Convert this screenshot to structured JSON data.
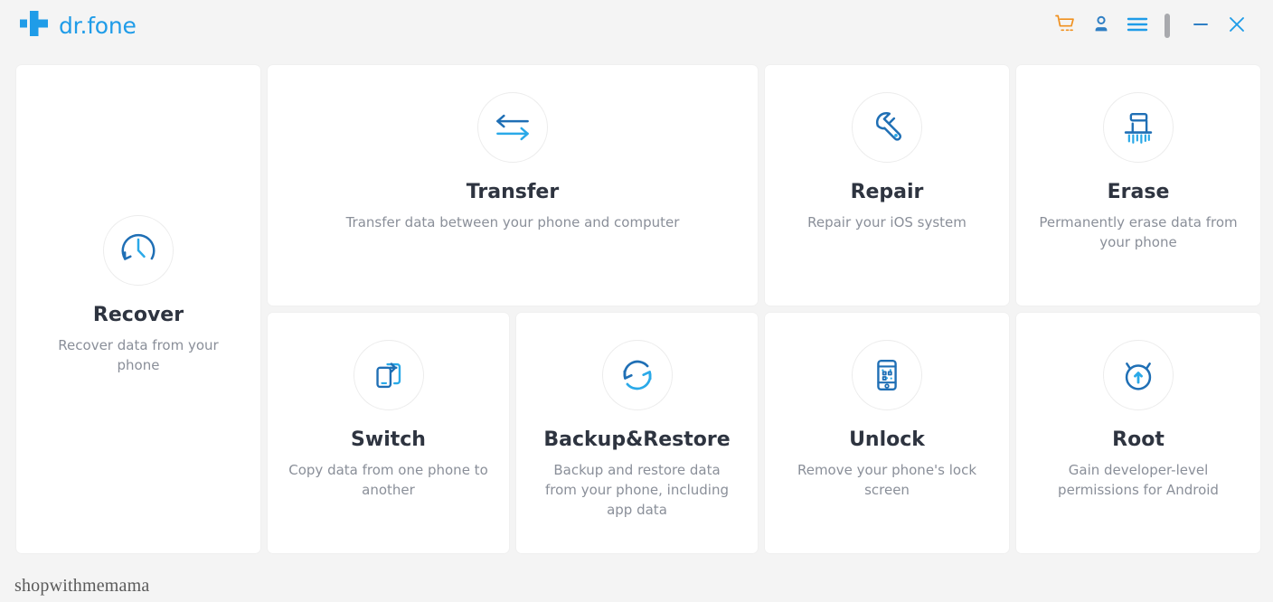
{
  "window": {
    "app_name": "dr.fone",
    "background_color": "#f4f4f4",
    "accent_color": "#1f9ce8",
    "cart_color": "#f0901e"
  },
  "titlebar": {
    "logo_icon": "plus-cross-icon",
    "actions": [
      {
        "name": "cart-icon",
        "label": "Store",
        "color": "#f0901e"
      },
      {
        "name": "account-icon",
        "label": "Account",
        "color": "#2f7fc4"
      },
      {
        "name": "menu-icon",
        "label": "Menu",
        "color": "#1f9ce8"
      },
      {
        "name": "divider",
        "label": "",
        "color": "#a8a9ad"
      },
      {
        "name": "minimize-icon",
        "label": "Minimize",
        "color": "#2f7fc4"
      },
      {
        "name": "close-icon",
        "label": "Close",
        "color": "#1f9ce8"
      }
    ]
  },
  "cards": {
    "recover": {
      "title": "Recover",
      "desc": "Recover data from your phone",
      "icon": "clock-history-icon"
    },
    "transfer": {
      "title": "Transfer",
      "desc": "Transfer data between your phone and computer",
      "icon": "two-way-arrows-icon"
    },
    "repair": {
      "title": "Repair",
      "desc": "Repair your iOS system",
      "icon": "wrench-icon"
    },
    "erase": {
      "title": "Erase",
      "desc": "Permanently erase data from your phone",
      "icon": "shredder-icon"
    },
    "switch": {
      "title": "Switch",
      "desc": "Copy data from one phone to another",
      "icon": "phone-transfer-icon"
    },
    "backup": {
      "title": "Backup&Restore",
      "desc": "Backup and restore data from your phone, including app data",
      "icon": "circular-sync-icon"
    },
    "unlock": {
      "title": "Unlock",
      "desc": "Remove your phone's lock screen",
      "icon": "phone-pattern-lock-icon"
    },
    "root": {
      "title": "Root",
      "desc": "Gain developer-level permissions for Android",
      "icon": "android-root-icon"
    }
  },
  "watermark": {
    "text": "shopwithmemama"
  }
}
